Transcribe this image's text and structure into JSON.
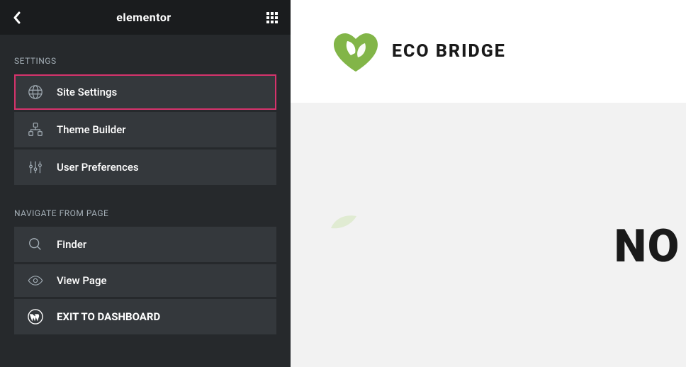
{
  "header": {
    "title": "elementor"
  },
  "sections": {
    "settings": {
      "label": "SETTINGS",
      "items": [
        {
          "label": "Site Settings"
        },
        {
          "label": "Theme Builder"
        },
        {
          "label": "User Preferences"
        }
      ]
    },
    "navigate": {
      "label": "NAVIGATE FROM PAGE",
      "items": [
        {
          "label": "Finder"
        },
        {
          "label": "View Page"
        },
        {
          "label": "EXIT TO DASHBOARD"
        }
      ]
    }
  },
  "preview": {
    "logo_text": "ECO BRIDGE",
    "body_text": "NO"
  }
}
